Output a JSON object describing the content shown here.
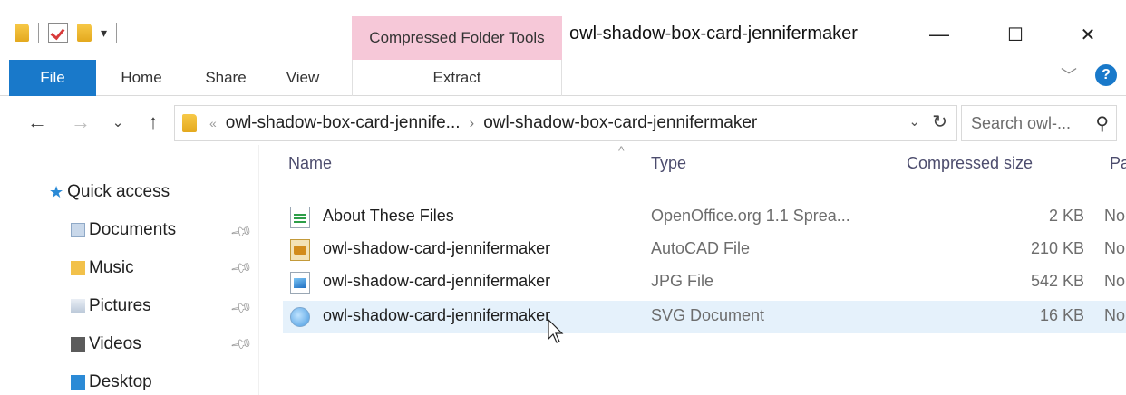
{
  "window": {
    "title": "owl-shadow-box-card-jennifermaker",
    "contextual_tab_group": "Compressed Folder Tools",
    "minimize": "—",
    "maximize": "☐",
    "close": "✕"
  },
  "ribbon": {
    "tabs": [
      "File",
      "Home",
      "Share",
      "View",
      "Extract"
    ],
    "collapse_icon": "chevron-down-icon",
    "help": "?"
  },
  "address": {
    "crumbs": [
      "owl-shadow-box-card-jennife...",
      "owl-shadow-box-card-jennifermaker"
    ],
    "overflow": "«",
    "separator": "›",
    "search_placeholder": "Search owl-..."
  },
  "nav": {
    "items": [
      {
        "label": "Quick access",
        "icon": "star-icon",
        "pinned": false
      },
      {
        "label": "Documents",
        "icon": "documents-folder-icon",
        "pinned": true
      },
      {
        "label": "Music",
        "icon": "music-folder-icon",
        "pinned": true
      },
      {
        "label": "Pictures",
        "icon": "pictures-folder-icon",
        "pinned": true
      },
      {
        "label": "Videos",
        "icon": "videos-folder-icon",
        "pinned": true
      },
      {
        "label": "Desktop",
        "icon": "desktop-folder-icon",
        "pinned": false
      }
    ]
  },
  "list": {
    "columns": [
      "Name",
      "Type",
      "Compressed size",
      "Pa"
    ],
    "rows": [
      {
        "name": "About These Files",
        "type": "OpenOffice.org 1.1 Sprea...",
        "size": "2 KB",
        "pa": "No",
        "icon": "spreadsheet-file-icon",
        "selected": false
      },
      {
        "name": "owl-shadow-card-jennifermaker",
        "type": "AutoCAD File",
        "size": "210 KB",
        "pa": "No",
        "icon": "autocad-file-icon",
        "selected": false
      },
      {
        "name": "owl-shadow-card-jennifermaker",
        "type": "JPG File",
        "size": "542 KB",
        "pa": "No",
        "icon": "jpg-file-icon",
        "selected": false
      },
      {
        "name": "owl-shadow-card-jennifermaker",
        "type": "SVG Document",
        "size": "16 KB",
        "pa": "No",
        "icon": "svg-file-icon",
        "selected": true
      }
    ]
  },
  "colors": {
    "file_tab": "#1979ca",
    "contextual_tab": "#f6c8d8",
    "selection": "#e5f1fb"
  }
}
